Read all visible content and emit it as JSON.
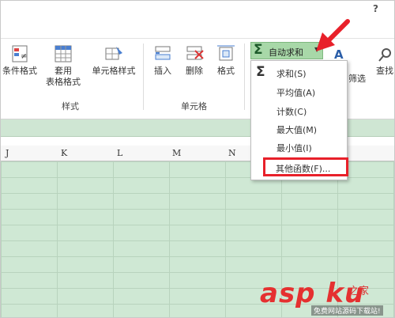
{
  "help_label": "?",
  "ribbon": {
    "cond_format": "条件格式",
    "table_format_1": "套用",
    "table_format_2": "表格格式",
    "cell_style": "单元格样式",
    "insert": "插入",
    "delete": "删除",
    "format": "格式",
    "group_styles": "样式",
    "group_cells": "单元格",
    "autosum": "自动求和",
    "filter": "筛选",
    "find": "查找"
  },
  "column_headers": [
    "J",
    "K",
    "L",
    "M",
    "N"
  ],
  "dropdown": {
    "items": [
      "求和(S)",
      "平均值(A)",
      "计数(C)",
      "最大值(M)",
      "最小值(I)",
      "其他函数(F)..."
    ]
  },
  "watermark": {
    "logo": "asp ku",
    "zh": "之家",
    "sub": "免费网站源码下载站!"
  },
  "colors": {
    "grid_fill": "#cfe8d4",
    "autosum_bg": "#a8d8a8",
    "highlight": "#e8202a",
    "arrow": "#e8202a"
  }
}
